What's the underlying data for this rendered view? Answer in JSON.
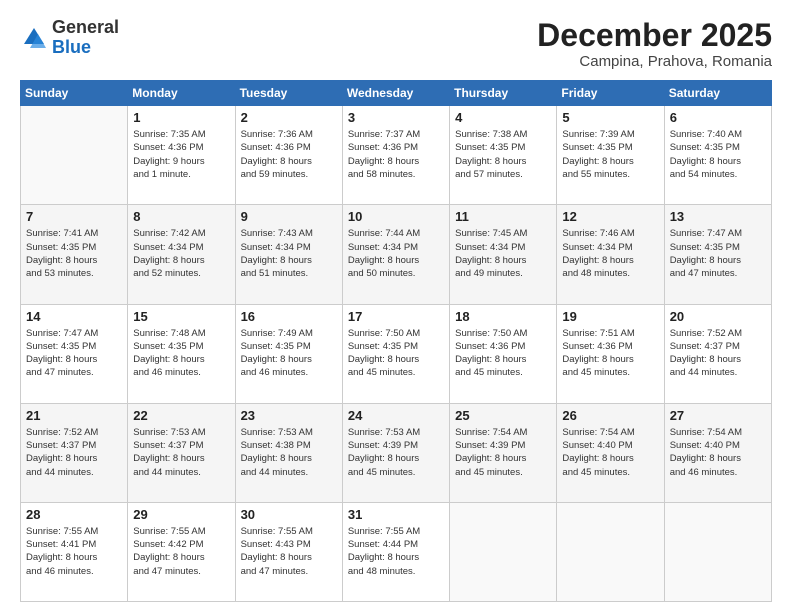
{
  "header": {
    "logo": {
      "general": "General",
      "blue": "Blue"
    },
    "title": "December 2025",
    "subtitle": "Campina, Prahova, Romania"
  },
  "days_of_week": [
    "Sunday",
    "Monday",
    "Tuesday",
    "Wednesday",
    "Thursday",
    "Friday",
    "Saturday"
  ],
  "weeks": [
    [
      {
        "num": "",
        "info": ""
      },
      {
        "num": "1",
        "info": "Sunrise: 7:35 AM\nSunset: 4:36 PM\nDaylight: 9 hours\nand 1 minute."
      },
      {
        "num": "2",
        "info": "Sunrise: 7:36 AM\nSunset: 4:36 PM\nDaylight: 8 hours\nand 59 minutes."
      },
      {
        "num": "3",
        "info": "Sunrise: 7:37 AM\nSunset: 4:36 PM\nDaylight: 8 hours\nand 58 minutes."
      },
      {
        "num": "4",
        "info": "Sunrise: 7:38 AM\nSunset: 4:35 PM\nDaylight: 8 hours\nand 57 minutes."
      },
      {
        "num": "5",
        "info": "Sunrise: 7:39 AM\nSunset: 4:35 PM\nDaylight: 8 hours\nand 55 minutes."
      },
      {
        "num": "6",
        "info": "Sunrise: 7:40 AM\nSunset: 4:35 PM\nDaylight: 8 hours\nand 54 minutes."
      }
    ],
    [
      {
        "num": "7",
        "info": "Sunrise: 7:41 AM\nSunset: 4:35 PM\nDaylight: 8 hours\nand 53 minutes."
      },
      {
        "num": "8",
        "info": "Sunrise: 7:42 AM\nSunset: 4:34 PM\nDaylight: 8 hours\nand 52 minutes."
      },
      {
        "num": "9",
        "info": "Sunrise: 7:43 AM\nSunset: 4:34 PM\nDaylight: 8 hours\nand 51 minutes."
      },
      {
        "num": "10",
        "info": "Sunrise: 7:44 AM\nSunset: 4:34 PM\nDaylight: 8 hours\nand 50 minutes."
      },
      {
        "num": "11",
        "info": "Sunrise: 7:45 AM\nSunset: 4:34 PM\nDaylight: 8 hours\nand 49 minutes."
      },
      {
        "num": "12",
        "info": "Sunrise: 7:46 AM\nSunset: 4:34 PM\nDaylight: 8 hours\nand 48 minutes."
      },
      {
        "num": "13",
        "info": "Sunrise: 7:47 AM\nSunset: 4:35 PM\nDaylight: 8 hours\nand 47 minutes."
      }
    ],
    [
      {
        "num": "14",
        "info": "Sunrise: 7:47 AM\nSunset: 4:35 PM\nDaylight: 8 hours\nand 47 minutes."
      },
      {
        "num": "15",
        "info": "Sunrise: 7:48 AM\nSunset: 4:35 PM\nDaylight: 8 hours\nand 46 minutes."
      },
      {
        "num": "16",
        "info": "Sunrise: 7:49 AM\nSunset: 4:35 PM\nDaylight: 8 hours\nand 46 minutes."
      },
      {
        "num": "17",
        "info": "Sunrise: 7:50 AM\nSunset: 4:35 PM\nDaylight: 8 hours\nand 45 minutes."
      },
      {
        "num": "18",
        "info": "Sunrise: 7:50 AM\nSunset: 4:36 PM\nDaylight: 8 hours\nand 45 minutes."
      },
      {
        "num": "19",
        "info": "Sunrise: 7:51 AM\nSunset: 4:36 PM\nDaylight: 8 hours\nand 45 minutes."
      },
      {
        "num": "20",
        "info": "Sunrise: 7:52 AM\nSunset: 4:37 PM\nDaylight: 8 hours\nand 44 minutes."
      }
    ],
    [
      {
        "num": "21",
        "info": "Sunrise: 7:52 AM\nSunset: 4:37 PM\nDaylight: 8 hours\nand 44 minutes."
      },
      {
        "num": "22",
        "info": "Sunrise: 7:53 AM\nSunset: 4:37 PM\nDaylight: 8 hours\nand 44 minutes."
      },
      {
        "num": "23",
        "info": "Sunrise: 7:53 AM\nSunset: 4:38 PM\nDaylight: 8 hours\nand 44 minutes."
      },
      {
        "num": "24",
        "info": "Sunrise: 7:53 AM\nSunset: 4:39 PM\nDaylight: 8 hours\nand 45 minutes."
      },
      {
        "num": "25",
        "info": "Sunrise: 7:54 AM\nSunset: 4:39 PM\nDaylight: 8 hours\nand 45 minutes."
      },
      {
        "num": "26",
        "info": "Sunrise: 7:54 AM\nSunset: 4:40 PM\nDaylight: 8 hours\nand 45 minutes."
      },
      {
        "num": "27",
        "info": "Sunrise: 7:54 AM\nSunset: 4:40 PM\nDaylight: 8 hours\nand 46 minutes."
      }
    ],
    [
      {
        "num": "28",
        "info": "Sunrise: 7:55 AM\nSunset: 4:41 PM\nDaylight: 8 hours\nand 46 minutes."
      },
      {
        "num": "29",
        "info": "Sunrise: 7:55 AM\nSunset: 4:42 PM\nDaylight: 8 hours\nand 47 minutes."
      },
      {
        "num": "30",
        "info": "Sunrise: 7:55 AM\nSunset: 4:43 PM\nDaylight: 8 hours\nand 47 minutes."
      },
      {
        "num": "31",
        "info": "Sunrise: 7:55 AM\nSunset: 4:44 PM\nDaylight: 8 hours\nand 48 minutes."
      },
      {
        "num": "",
        "info": ""
      },
      {
        "num": "",
        "info": ""
      },
      {
        "num": "",
        "info": ""
      }
    ]
  ]
}
